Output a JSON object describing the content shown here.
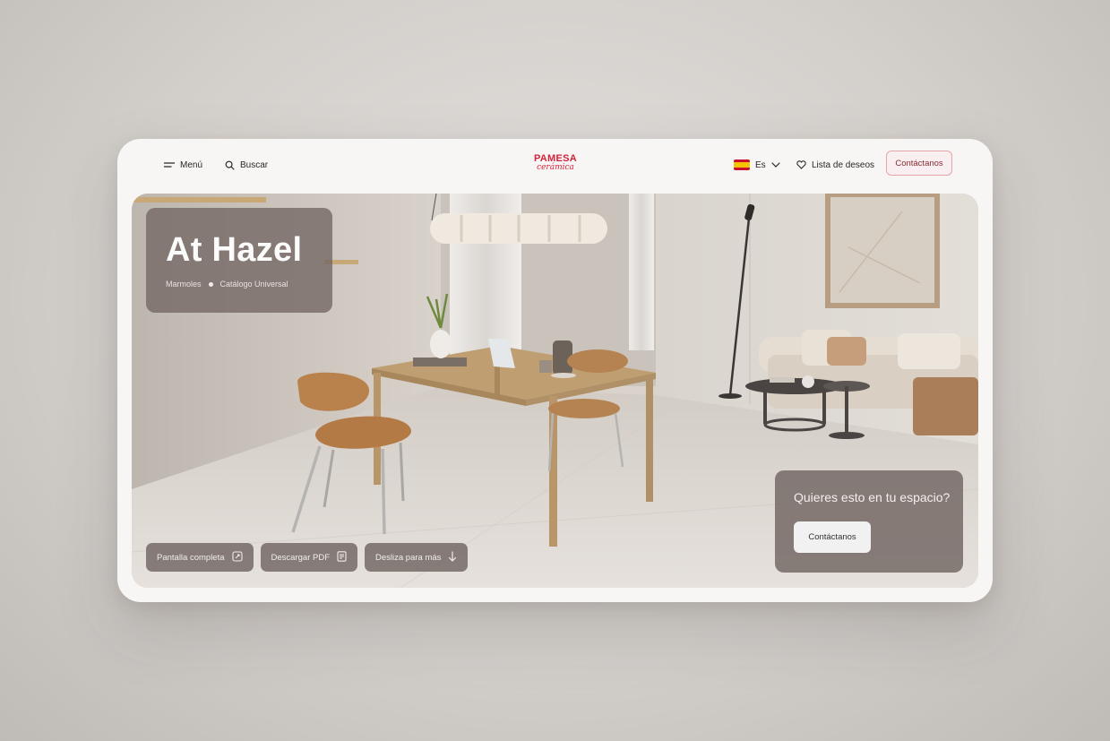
{
  "header": {
    "menu_label": "Menú",
    "search_label": "Buscar",
    "logo_top": "PAMESA",
    "logo_bottom": "cerámica",
    "language_label": "Es",
    "wishlist_label": "Lista de deseos",
    "contact_label": "Contáctanos"
  },
  "hero": {
    "title": "At Hazel",
    "category": "Marmoles",
    "catalog": "Catálogo Universal",
    "actions": {
      "fullscreen_label": "Pantalla completa",
      "download_label": "Descargar PDF",
      "scroll_label": "Desliza para más"
    },
    "cta": {
      "question": "Quieres esto en tu espacio?",
      "button_label": "Contáctanos"
    }
  },
  "colors": {
    "brand": "#d8223a",
    "panel": "#766a66",
    "page_background": "#d9d5d1",
    "card_background": "#f7f6f5"
  },
  "icons": [
    "menu-icon",
    "search-icon",
    "spain-flag-icon",
    "chevron-down-icon",
    "heart-icon",
    "fullscreen-icon",
    "document-icon",
    "arrow-down-icon"
  ]
}
